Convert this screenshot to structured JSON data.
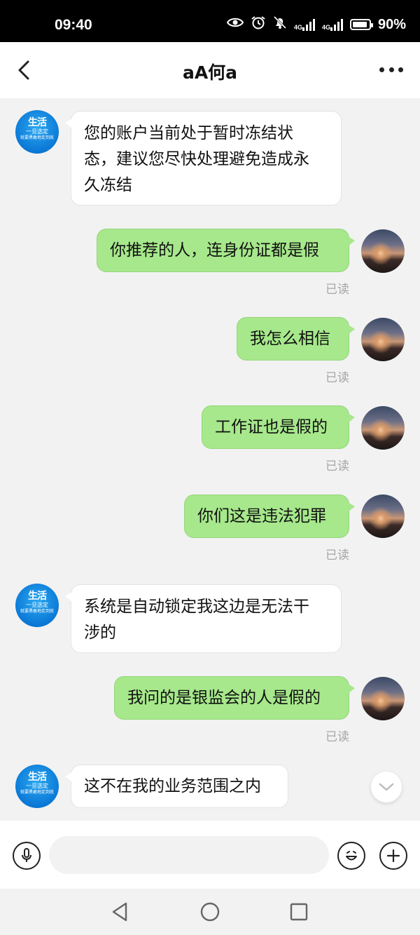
{
  "status_bar": {
    "time": "09:40",
    "net1": "4G",
    "net2": "4G",
    "battery": "90%"
  },
  "header": {
    "title": "aA何a",
    "icons": {
      "back": "chevron-left-icon",
      "more": "more-dots-icon"
    }
  },
  "avatars": {
    "other": {
      "line1": "生活",
      "line2": "一旦选定",
      "line3": "就要勇敢地走到底"
    }
  },
  "messages": [
    {
      "from": "other",
      "text_lines": [
        "您的账户当前处于暂时冻结状",
        "态，建议您尽快处理避免造成永",
        "久冻结"
      ]
    },
    {
      "from": "me",
      "text": "你推荐的人，连身份证都是假",
      "status": "已读"
    },
    {
      "from": "me",
      "text": "我怎么相信",
      "status": "已读"
    },
    {
      "from": "me",
      "text": "工作证也是假的",
      "status": "已读"
    },
    {
      "from": "me",
      "text": "你们这是违法犯罪",
      "status": "已读"
    },
    {
      "from": "other",
      "text_lines": [
        "系统是自动锁定我这边是无法干",
        "涉的"
      ]
    },
    {
      "from": "me",
      "text": "我问的是银监会的人是假的",
      "status": "已读"
    },
    {
      "from": "other",
      "text": "这不在我的业务范围之内"
    }
  ],
  "input_bar": {
    "placeholder": "",
    "icons": {
      "voice": "microphone-icon",
      "emoji": "emoji-icon",
      "add": "plus-icon"
    }
  },
  "nav": {
    "icons": [
      "back-triangle-icon",
      "home-circle-icon",
      "recents-square-icon"
    ]
  },
  "colors": {
    "outgoing_bubble": "#a6e88b",
    "incoming_bubble": "#ffffff",
    "chat_bg": "#f2f2f2"
  }
}
